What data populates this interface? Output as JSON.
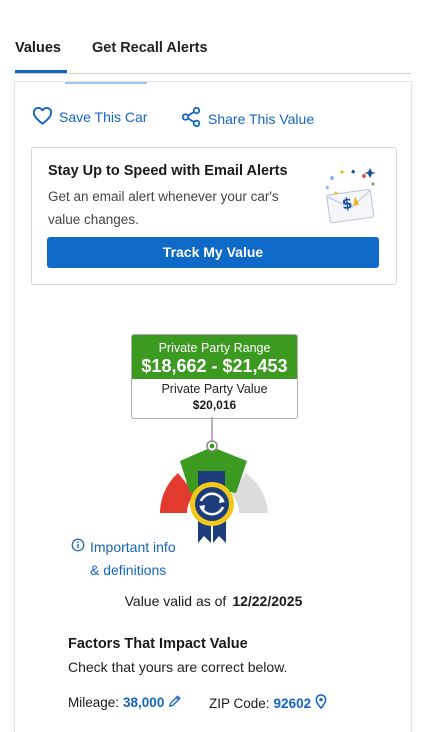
{
  "tabs": [
    {
      "label": "Values",
      "active": true
    },
    {
      "label": "Get Recall Alerts",
      "active": false
    }
  ],
  "actions": {
    "save_label": "Save This Car",
    "share_label": "Share This Value"
  },
  "email_alert": {
    "title": "Stay Up to Speed with Email Alerts",
    "description": "Get an email alert whenever your car's value changes.",
    "button_label": "Track My Value"
  },
  "valuation": {
    "range_label": "Private Party Range",
    "range_value": "$18,662 - $21,453",
    "value_label": "Private Party Value",
    "value": "$20,016",
    "info_link_line1": "Important info",
    "info_link_line2": "& definitions",
    "valid_label": "Value valid as of",
    "valid_date": "12/22/2025"
  },
  "factors": {
    "title": "Factors That Impact Value",
    "subtitle": "Check that yours are correct below.",
    "mileage_label": "Mileage:",
    "mileage_value": "38,000",
    "zip_label": "ZIP Code:",
    "zip_value": "92602"
  },
  "colors": {
    "accent": "#1565c0",
    "button": "#0f6ac7",
    "range_green": "#3c9a21",
    "gauge_red": "#e23b2e",
    "gauge_grey": "#dcdcdc",
    "ribbon_navy": "#1d3d7a",
    "ribbon_gold": "#f2c81b"
  },
  "icons": {
    "save": "heart-icon",
    "share": "share-icon",
    "info": "info-icon",
    "edit": "pencil-icon",
    "location": "map-pin-icon"
  }
}
